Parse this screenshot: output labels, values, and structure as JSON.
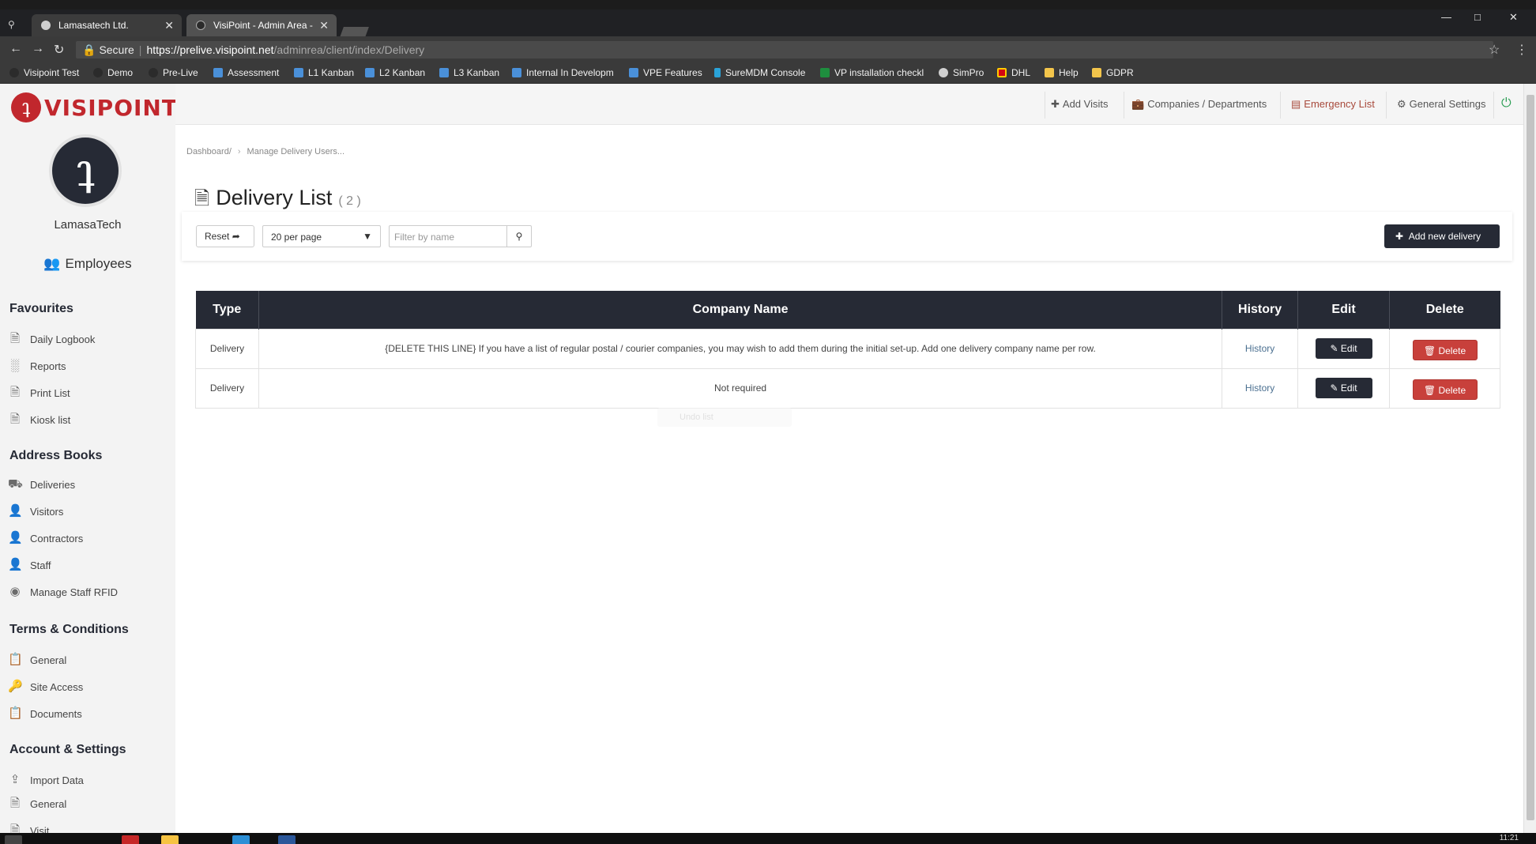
{
  "browser": {
    "tabs": [
      {
        "title": "Lamasatech Ltd."
      },
      {
        "title": "VisiPoint - Admin Area -"
      }
    ],
    "security_label": "Secure",
    "url_host": "https://prelive.visipoint.net",
    "url_path": "/adminrea/client/index/Delivery",
    "bookmarks": [
      {
        "label": "Visipoint Test",
        "color": "#2b2b2b"
      },
      {
        "label": "Demo",
        "color": "#2b2b2b"
      },
      {
        "label": "Pre-Live",
        "color": "#2b2b2b"
      },
      {
        "label": "Assessment",
        "color": "#4a90d9"
      },
      {
        "label": "L1 Kanban",
        "color": "#4a90d9"
      },
      {
        "label": "L2 Kanban",
        "color": "#4a90d9"
      },
      {
        "label": "L3 Kanban",
        "color": "#4a90d9"
      },
      {
        "label": "Internal In Developm",
        "color": "#4a90d9"
      },
      {
        "label": "VPE Features",
        "color": "#4a90d9"
      },
      {
        "label": "SureMDM Console",
        "color": "#2aa3d9"
      },
      {
        "label": "VP installation checkl",
        "color": "#1e8e3e"
      },
      {
        "label": "SimPro",
        "color": "#d0d0d0"
      },
      {
        "label": "DHL",
        "color": "#d40511"
      },
      {
        "label": "Help",
        "color": "#f3c54b"
      },
      {
        "label": "GDPR",
        "color": "#f3c54b"
      }
    ],
    "clock": "11:21"
  },
  "app": {
    "logo_text": "VISIPOINT",
    "org_name": "LamasaTech",
    "employees_label": "Employees",
    "sections": {
      "favourites": "Favourites",
      "address_books": "Address Books",
      "terms": "Terms & Conditions",
      "account": "Account & Settings"
    },
    "favourites": [
      {
        "label": "Daily Logbook",
        "icon": "document-icon"
      },
      {
        "label": "Reports",
        "icon": "bar-chart-icon"
      },
      {
        "label": "Print List",
        "icon": "document-icon"
      },
      {
        "label": "Kiosk list",
        "icon": "document-icon"
      }
    ],
    "address_books": [
      {
        "label": "Deliveries",
        "icon": "truck-icon"
      },
      {
        "label": "Visitors",
        "icon": "user-icon"
      },
      {
        "label": "Contractors",
        "icon": "user-icon"
      },
      {
        "label": "Staff",
        "icon": "user-icon"
      },
      {
        "label": "Manage Staff RFID",
        "icon": "rfid-icon"
      }
    ],
    "terms": [
      {
        "label": "General",
        "icon": "clipboard-icon"
      },
      {
        "label": "Site Access",
        "icon": "key-icon"
      },
      {
        "label": "Documents",
        "icon": "clipboard-icon"
      }
    ],
    "account": [
      {
        "label": "Import Data",
        "icon": "upload-icon"
      },
      {
        "label": "General",
        "icon": "document-icon"
      },
      {
        "label": "Visit",
        "icon": "document-icon"
      }
    ],
    "topnav": {
      "add_visits": "Add Visits",
      "companies": "Companies / Departments",
      "emergency": "Emergency List",
      "settings": "General Settings"
    },
    "breadcrumb": {
      "dashboard": "Dashboard/",
      "current": "Manage Delivery Users..."
    },
    "page_title": "Delivery List",
    "page_count": "( 2 )",
    "toolbar": {
      "reset": "Reset",
      "per_page": "20 per page",
      "filter_placeholder": "Filter by name",
      "add_new": "Add new delivery"
    },
    "table": {
      "headers": {
        "type": "Type",
        "company": "Company Name",
        "history": "History",
        "edit": "Edit",
        "delete": "Delete"
      },
      "rows": [
        {
          "type": "Delivery",
          "company": "{DELETE THIS LINE} If you have a list of regular postal / courier companies, you may wish to add them during the initial set-up. Add one delivery company name per row.",
          "history": "History",
          "edit": "Edit",
          "delete": "Delete"
        },
        {
          "type": "Delivery",
          "company": "Not required",
          "history": "History",
          "edit": "Edit",
          "delete": "Delete"
        }
      ]
    },
    "ghost_text": "Undo list"
  }
}
